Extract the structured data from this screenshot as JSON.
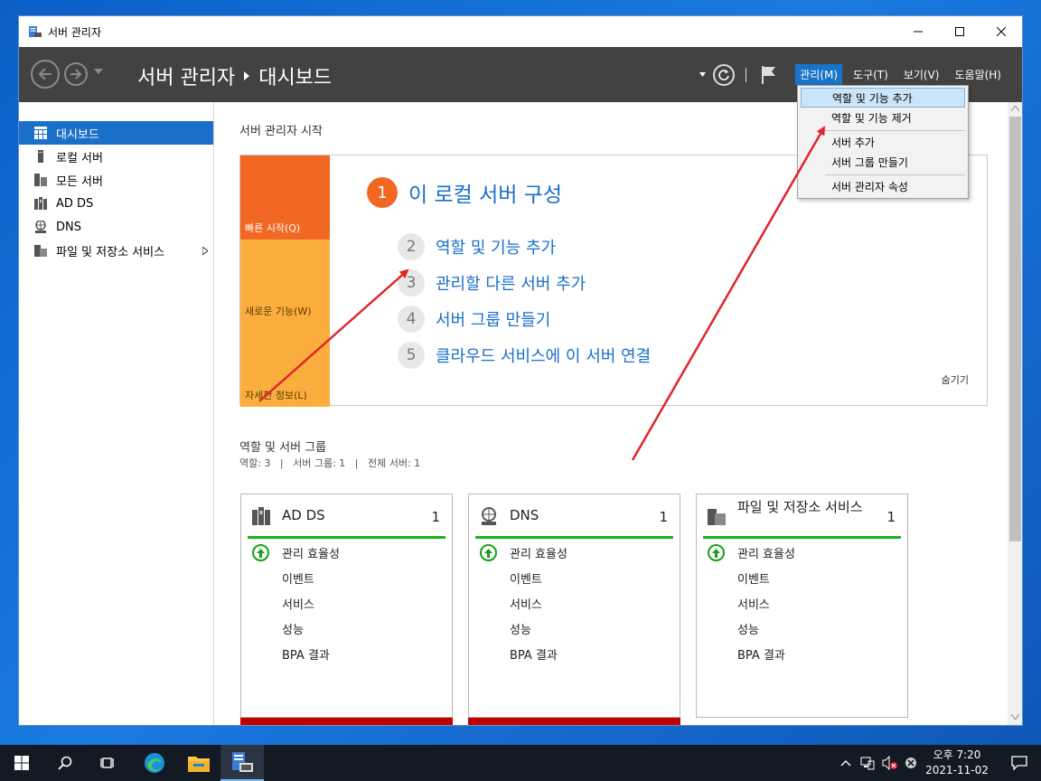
{
  "window": {
    "title": "서버 관리자"
  },
  "header": {
    "breadcrumb_root": "서버 관리자",
    "breadcrumb_page": "대시보드",
    "menus": [
      {
        "label": "관리(M)"
      },
      {
        "label": "도구(T)"
      },
      {
        "label": "보기(V)"
      },
      {
        "label": "도움말(H)"
      }
    ]
  },
  "manage_menu": {
    "items": [
      {
        "label": "역할 및 기능 추가"
      },
      {
        "label": "역할 및 기능 제거"
      },
      {
        "label": "서버 추가"
      },
      {
        "label": "서버 그룹 만들기"
      },
      {
        "label": "서버 관리자 속성"
      }
    ]
  },
  "sidebar": {
    "items": [
      {
        "label": "대시보드",
        "icon": "dashboard-icon"
      },
      {
        "label": "로컬 서버",
        "icon": "server-icon"
      },
      {
        "label": "모든 서버",
        "icon": "servers-icon"
      },
      {
        "label": "AD DS",
        "icon": "adds-icon"
      },
      {
        "label": "DNS",
        "icon": "dns-icon"
      },
      {
        "label": "파일 및 저장소 서비스",
        "icon": "file-storage-icon"
      }
    ]
  },
  "main": {
    "welcome_title": "서버 관리자 시작",
    "quick_start": {
      "tiles": [
        "빠른 시작(Q)",
        "새로운 기능(W)",
        "자세한 정보(L)"
      ],
      "heading_num": "1",
      "heading": "이 로컬 서버 구성",
      "steps": [
        {
          "num": "2",
          "label": "역할 및 기능 추가"
        },
        {
          "num": "3",
          "label": "관리할 다른 서버 추가"
        },
        {
          "num": "4",
          "label": "서버 그룹 만들기"
        },
        {
          "num": "5",
          "label": "클라우드 서비스에 이 서버 연결"
        }
      ],
      "hide": "숨기기"
    },
    "roles": {
      "title": "역할 및 서버 그룹",
      "counts": "역할: 3   |   서버 그룹: 1   |   전체 서버: 1",
      "cards": [
        {
          "title": "AD DS",
          "count": "1",
          "rows": [
            "관리 효율성",
            "이벤트",
            "서비스",
            "성능",
            "BPA 결과"
          ]
        },
        {
          "title": "DNS",
          "count": "1",
          "rows": [
            "관리 효율성",
            "이벤트",
            "서비스",
            "성능",
            "BPA 결과"
          ]
        },
        {
          "title": "파일 및 저장소 서비스",
          "count": "1",
          "rows": [
            "관리 효율성",
            "이벤트",
            "서비스",
            "성능",
            "BPA 결과"
          ]
        }
      ]
    }
  },
  "taskbar": {
    "time": "오후 7:20",
    "date": "2021-11-02"
  },
  "colors": {
    "accent": "#1a6fc8",
    "quick_start_orange": "#f26722",
    "tile_light_orange": "#fbae3d",
    "status_green": "#1cb51c",
    "header_dark": "#424242",
    "annotation_red": "#e0252b"
  }
}
